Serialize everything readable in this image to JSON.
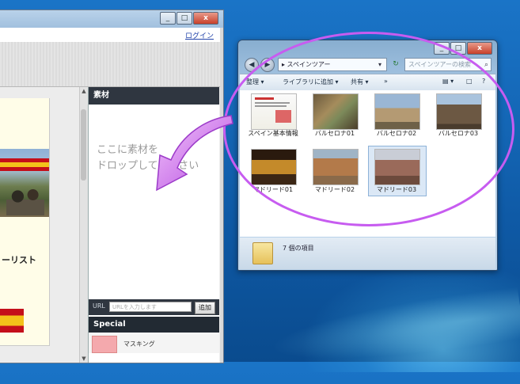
{
  "app": {
    "login_link": "ログイン",
    "window_buttons": {
      "minimize": "_",
      "maximize": "□",
      "close": "x"
    },
    "slide_caption": "ーリスト",
    "panel": {
      "title": "素材",
      "drop_hint_line1": "ここに素材を",
      "drop_hint_line2": "ドロップしてください",
      "url_label": "URL",
      "url_placeholder": "URLを入力します",
      "add_button": "追加",
      "special_title": "Special",
      "special_item_label": "マスキング",
      "special_item_color": "#f4a9ad"
    }
  },
  "explorer": {
    "window_buttons": {
      "minimize": "_",
      "maximize": "□",
      "close": "x"
    },
    "back": "◀",
    "forward": "▶",
    "address": "▸ スペインツアー",
    "address_dropdown": "▾",
    "refresh": "↻",
    "search_placeholder": "スペインツアーの検索",
    "search_icon": "⌕",
    "toolbar": {
      "organize": "整理 ▾",
      "library": "ライブラリに追加 ▾",
      "share": "共有 ▾",
      "more": "»",
      "views": "▤ ▾",
      "preview": "□",
      "help": "?"
    },
    "items": [
      {
        "label": "スペイン基本情報",
        "kind": "document"
      },
      {
        "label": "バルセロナ01",
        "kind": "photo"
      },
      {
        "label": "バルセロナ02",
        "kind": "photo"
      },
      {
        "label": "バルセロナ03",
        "kind": "photo"
      },
      {
        "label": "マドリード01",
        "kind": "photo"
      },
      {
        "label": "マドリード02",
        "kind": "photo"
      },
      {
        "label": "マドリード03",
        "kind": "photo",
        "selected": true
      }
    ],
    "status": "7 個の項目"
  },
  "colors": {
    "overlay": "#c75cf0",
    "panel_header": "#2f3640",
    "desktop": "#1466b5"
  }
}
